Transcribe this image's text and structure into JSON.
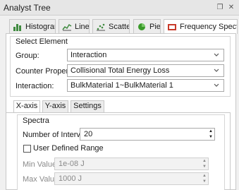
{
  "panel": {
    "title": "Analyst Tree"
  },
  "titlebar_icons": {
    "float": "restore-icon",
    "close": "close-icon"
  },
  "tabs": [
    {
      "label": "Histogram",
      "icon": "histogram-icon"
    },
    {
      "label": "Line",
      "icon": "line-chart-icon"
    },
    {
      "label": "Scatter",
      "icon": "scatter-icon"
    },
    {
      "label": "Pie",
      "icon": "pie-icon"
    },
    {
      "label": "Frequency Spectra",
      "icon": "frequency-spectra-icon"
    }
  ],
  "active_tab": "Frequency Spectra",
  "select_element": {
    "title": "Select Element",
    "group": {
      "label": "Group:",
      "value": "Interaction"
    },
    "counter_property": {
      "label": "Counter Property:",
      "value": "Collisional Total Energy Loss"
    },
    "interaction": {
      "label": "Interaction:",
      "value": "BulkMaterial 1~BulkMaterial 1"
    }
  },
  "subtabs": [
    {
      "label": "X-axis"
    },
    {
      "label": "Y-axis"
    },
    {
      "label": "Settings"
    }
  ],
  "active_subtab": "X-axis",
  "spectra": {
    "title": "Spectra",
    "intervals": {
      "label": "Number of Intervals:",
      "value": "20"
    },
    "user_defined_range": {
      "label": "User Defined Range",
      "checked": false
    },
    "min_value": {
      "label": "Min Value:",
      "value": "1e-08 J"
    },
    "max_value": {
      "label": "Max Value:",
      "value": "1000 J"
    }
  },
  "colors": {
    "pie_green": "#3a9a2a",
    "accent_red": "#c83a2a",
    "chart_green": "#3f8a3f"
  }
}
